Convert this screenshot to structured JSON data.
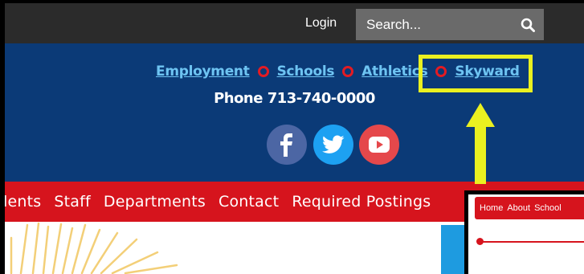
{
  "topbar": {
    "login_label": "Login",
    "search_placeholder": "Search...",
    "search_icon": "search-icon"
  },
  "quicklinks": [
    {
      "label": "Employment"
    },
    {
      "label": "Schools"
    },
    {
      "label": "Athletics"
    },
    {
      "label": "Skyward"
    }
  ],
  "highlighted_link": "Skyward",
  "phone": "Phone 713-740-0000",
  "social": [
    {
      "icon": "facebook-icon"
    },
    {
      "icon": "twitter-icon"
    },
    {
      "icon": "youtube-icon"
    }
  ],
  "nav": [
    {
      "label": "udents"
    },
    {
      "label": "Staff"
    },
    {
      "label": "Departments"
    },
    {
      "label": "Contact"
    },
    {
      "label": "Required Postings"
    }
  ],
  "inset_nav": [
    {
      "label": "Home"
    },
    {
      "label": "About"
    },
    {
      "label": "School"
    }
  ],
  "colors": {
    "topbar": "#2b2b2b",
    "header_blue": "#0b3a77",
    "nav_red": "#d6141d",
    "link_blue": "#6ec4f2",
    "highlight_yellow": "#eaf020"
  }
}
